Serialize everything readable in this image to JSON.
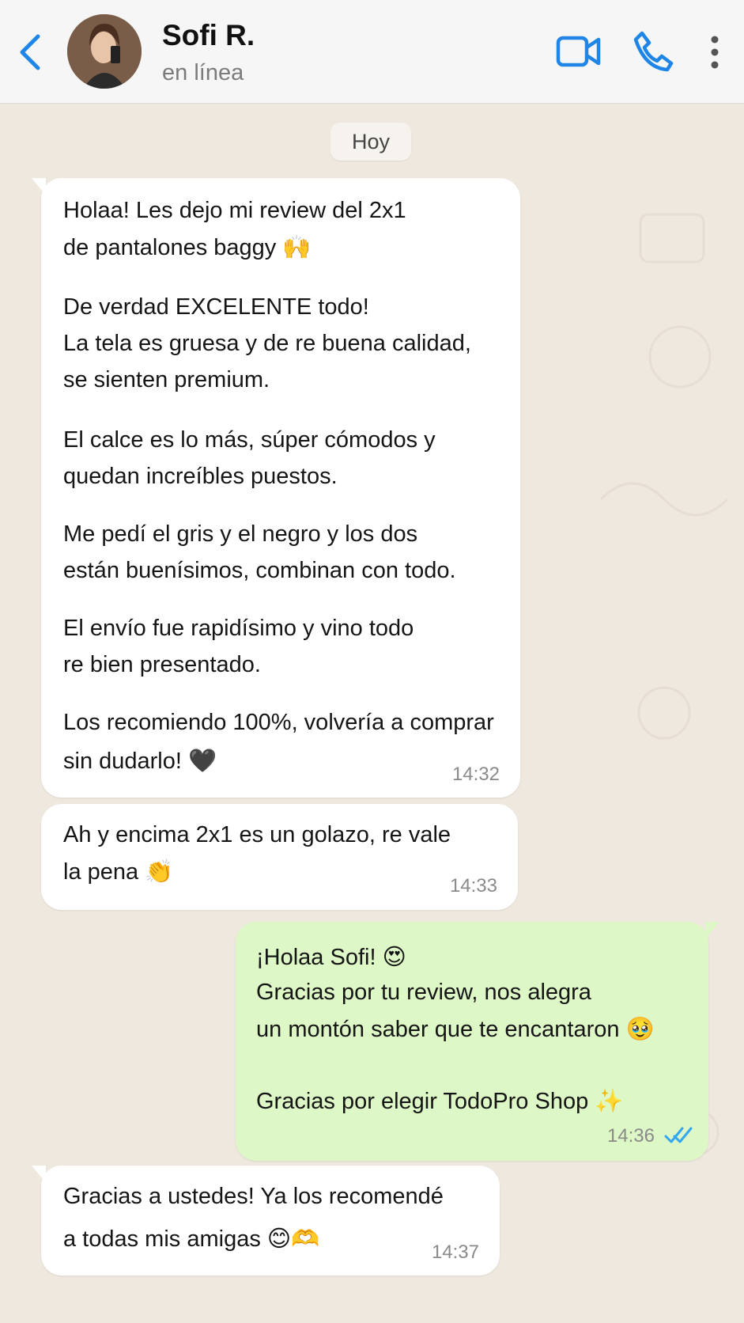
{
  "header": {
    "name": "Sofi R.",
    "status": "en línea",
    "accent": "#1f86e8"
  },
  "chat": {
    "day_chip": "Hoy",
    "messages": [
      {
        "direction": "in",
        "time": "14:32",
        "lines": [
          "Holaa! Les dejo mi review del 2x1",
          "de pantalones baggy 🙌",
          "De verdad EXCELENTE todo!",
          "La tela es gruesa y de re buena calidad,",
          "se sienten premium.",
          "El calce es lo más, súper cómodos y",
          "quedan increíbles puestos.",
          "Me pedí el gris y el negro y los dos",
          "están buenísimos, combinan con todo.",
          "El envío fue rapidísimo y vino todo",
          "re bien presentado.",
          "Los recomiendo 100%, volvería a comprar",
          "sin dudarlo! 🖤"
        ]
      },
      {
        "direction": "in",
        "time": "14:33",
        "lines": [
          "Ah y encima 2x1 es un golazo, re vale",
          "la pena 👏"
        ]
      },
      {
        "direction": "out",
        "time": "14:36",
        "read": true,
        "lines": [
          "¡Holaa Sofi! 😍",
          "Gracias por tu review, nos alegra",
          "un montón saber que te encantaron 🥹",
          "Gracias por elegir TodoPro Shop ✨"
        ]
      },
      {
        "direction": "in",
        "time": "14:37",
        "lines": [
          "Gracias a ustedes! Ya los recomendé",
          "a todas mis amigas 😊🫶"
        ]
      }
    ]
  },
  "colors": {
    "background": "#efe8df",
    "incoming_bubble": "#ffffff",
    "outgoing_bubble": "#ddf7c6",
    "read_ticks": "#34a6f0"
  }
}
